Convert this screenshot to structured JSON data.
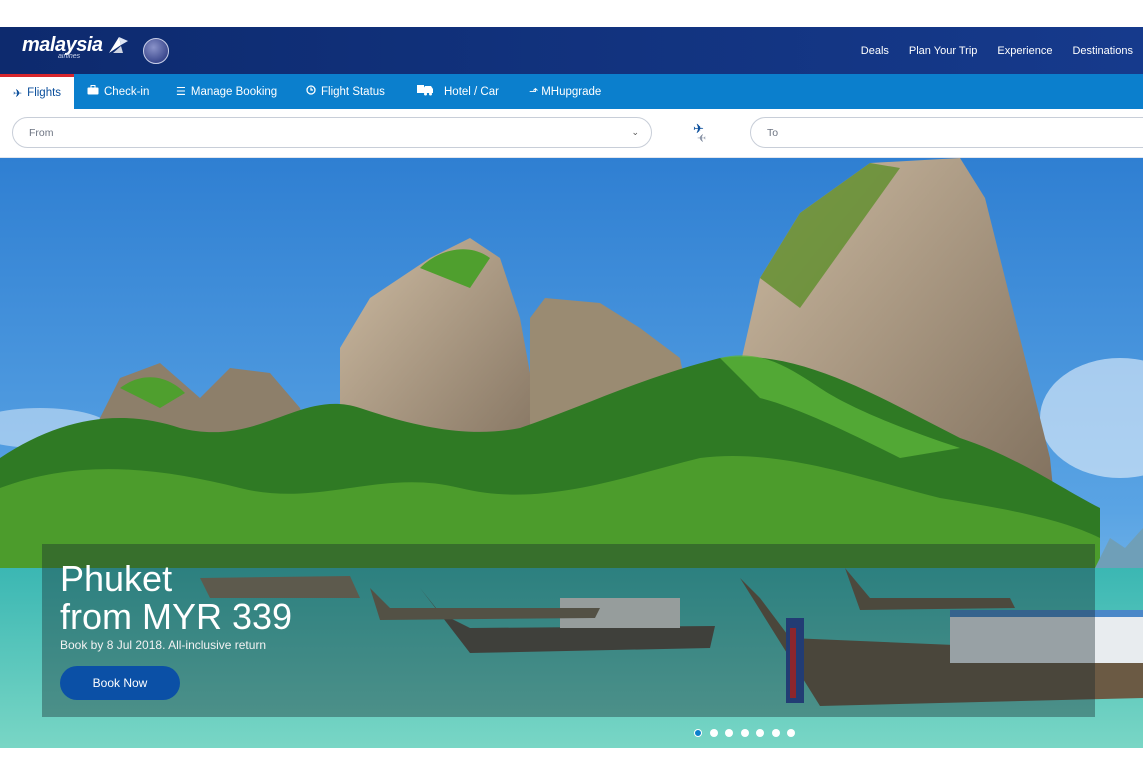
{
  "brand": {
    "logo_text": "malaysia",
    "logo_sub": "airlines"
  },
  "colors": {
    "navy": "#12337f",
    "tab_blue": "#0b7fcd",
    "accent_red": "#d7262d",
    "button": "#0b50a6"
  },
  "top_nav": [
    "Deals",
    "Plan Your Trip",
    "Experience",
    "Destinations"
  ],
  "tabs": [
    {
      "label": "Flights",
      "icon": "plane-icon",
      "active": true
    },
    {
      "label": "Check-in",
      "icon": "briefcase-icon",
      "active": false
    },
    {
      "label": "Manage Booking",
      "icon": "list-icon",
      "active": false
    },
    {
      "label": "Flight Status",
      "icon": "clock-icon",
      "active": false
    },
    {
      "label": "Hotel / Car",
      "icon": "car-icon",
      "active": false
    },
    {
      "label": "MHupgrade",
      "icon": "upgrade-icon",
      "active": false
    }
  ],
  "search": {
    "from_placeholder": "From",
    "to_placeholder": "To"
  },
  "hero": {
    "destination": "Phuket",
    "price": "from MYR 339",
    "note": "Book by 8 Jul 2018. All-inclusive return",
    "cta": "Book Now",
    "slides_total": 7,
    "active_slide": 1
  }
}
